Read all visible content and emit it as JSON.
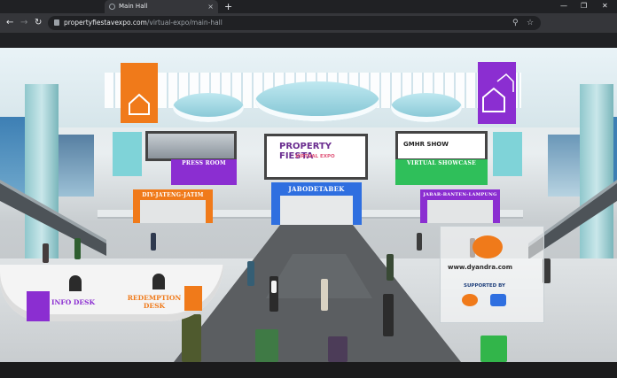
{
  "browser": {
    "tab_title": "Main Hall",
    "new_tab": "+",
    "tab_close": "×",
    "window_controls": {
      "minimize": "—",
      "maximize": "❐",
      "close": "✕"
    },
    "nav": {
      "back": "←",
      "forward": "→",
      "reload": "↻"
    },
    "url_host": "propertyfiestavexpo.com",
    "url_path": "/virtual-expo/main-hall",
    "omnibox_icons": {
      "zoom": "⚲",
      "bookmark": "☆"
    }
  },
  "hall": {
    "boards": {
      "press_room": "PRESS ROOM",
      "virtual_showcase": "VIRTUAL SHOWCASE",
      "diy_jateng_jatim": "DIY-JATENG-JATIM",
      "jabodetabek": "JABODETABEK",
      "jabar_banten_lampung": "JABAR-BANTEN-LAMPUNG"
    },
    "hero_screen": {
      "title": "PROPERTY FIESTA",
      "subtitle": "VIRTUAL EXPO"
    },
    "right_screen": {
      "title": "GMHR SHOW"
    },
    "desks": {
      "info": "INFO DESK",
      "redemption": "REDEMPTION DESK"
    },
    "sponsor_stand": {
      "url": "www.dyandra.com",
      "supported_by": "SUPPORTED BY"
    }
  },
  "colors": {
    "purple": "#8b2ed1",
    "orange": "#f07a1a",
    "blue": "#2f6fe0",
    "green": "#2fbf5a",
    "teal": "#7fd3d8",
    "carpet": "#5b5e61"
  }
}
